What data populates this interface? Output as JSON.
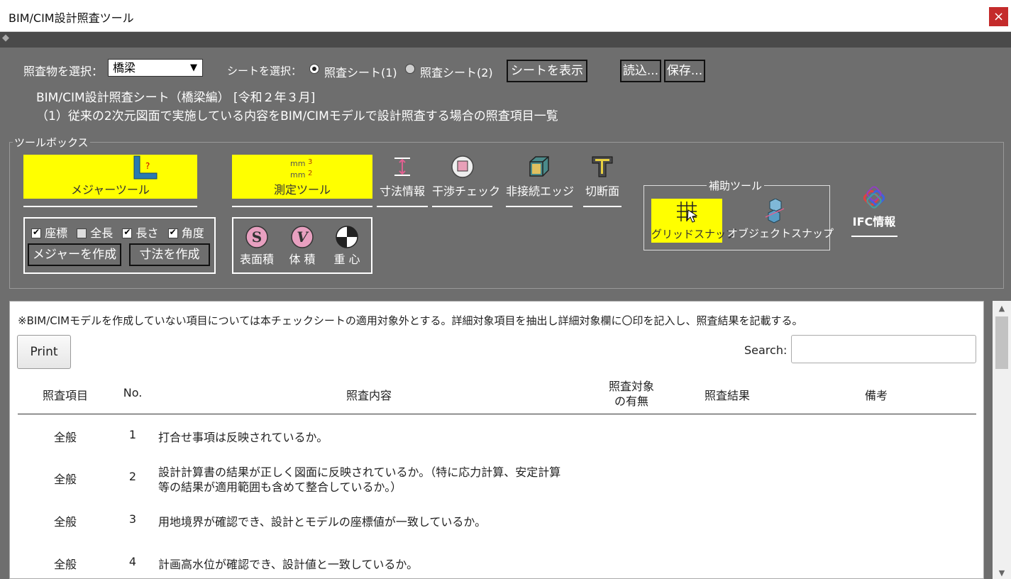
{
  "window": {
    "title": "BIM/CIM設計照査ツール",
    "close_glyph": "×"
  },
  "header": {
    "target_label": "照査物を選択：",
    "target_value": "橋梁",
    "sheet_label": "シートを選択：",
    "sheet_options": [
      "照査シート(1)",
      "照査シート(2)"
    ],
    "show_sheet_button": "シートを表示",
    "load_button": "読込...",
    "save_button": "保存...",
    "sheet_title": "BIM/CIM設計照査シート（橋梁編） [令和２年３月]",
    "sheet_subtitle": "（1）従来の2次元図面で実施している内容をBIM/CIMモデルで設計照査する場合の照査項目一覧"
  },
  "toolbox": {
    "legend": "ツールボックス",
    "measure_tool": "メジャーツール",
    "measurement_tool": "測定ツール",
    "tools": [
      "寸法情報",
      "干渉チェック",
      "非接続エッジ",
      "切断面"
    ],
    "checkboxes": [
      "座標",
      "全長",
      "長さ",
      "角度"
    ],
    "create_measure_button": "メジャーを作成",
    "create_dimension_button": "寸法を作成",
    "calc_tools": [
      "表面積",
      "体 積",
      "重 心"
    ],
    "aux_legend": "補助ツール",
    "grid_snap": "グリッドスナップ",
    "object_snap": "オブジェクトスナップ",
    "ifc_info": "IFC情報",
    "icon_glyphs": {
      "surface": "S",
      "volume": "V"
    }
  },
  "content": {
    "note": "※BIM/CIMモデルを作成していない項目については本チェックシートの適用対象外とする。詳細対象項目を抽出し詳細対象欄に〇印を記入し、照査結果を記載する。",
    "print_button": "Print",
    "search_label": "Search:",
    "columns": [
      "照査項目",
      "No.",
      "照査内容",
      "照査対象",
      "の有無",
      "照査結果",
      "備考"
    ],
    "rows": [
      {
        "item": "全般",
        "no": "1",
        "content": "打合せ事項は反映されているか。"
      },
      {
        "item": "全般",
        "no": "2",
        "content": "設計計算書の結果が正しく図面に反映されているか。（特に応力計算、安定計算",
        "content2": "等の結果が適用範囲も含めて整合しているか。）"
      },
      {
        "item": "全般",
        "no": "3",
        "content": "用地境界が確認でき、設計とモデルの座標値が一致しているか。"
      },
      {
        "item": "全般",
        "no": "4",
        "content": "計画高水位が確認でき、設計値と一致しているか。"
      }
    ]
  },
  "colors": {
    "toolbar_bg": "#6e6e6e",
    "highlight": "#ffff00",
    "close": "#c42b2b"
  }
}
